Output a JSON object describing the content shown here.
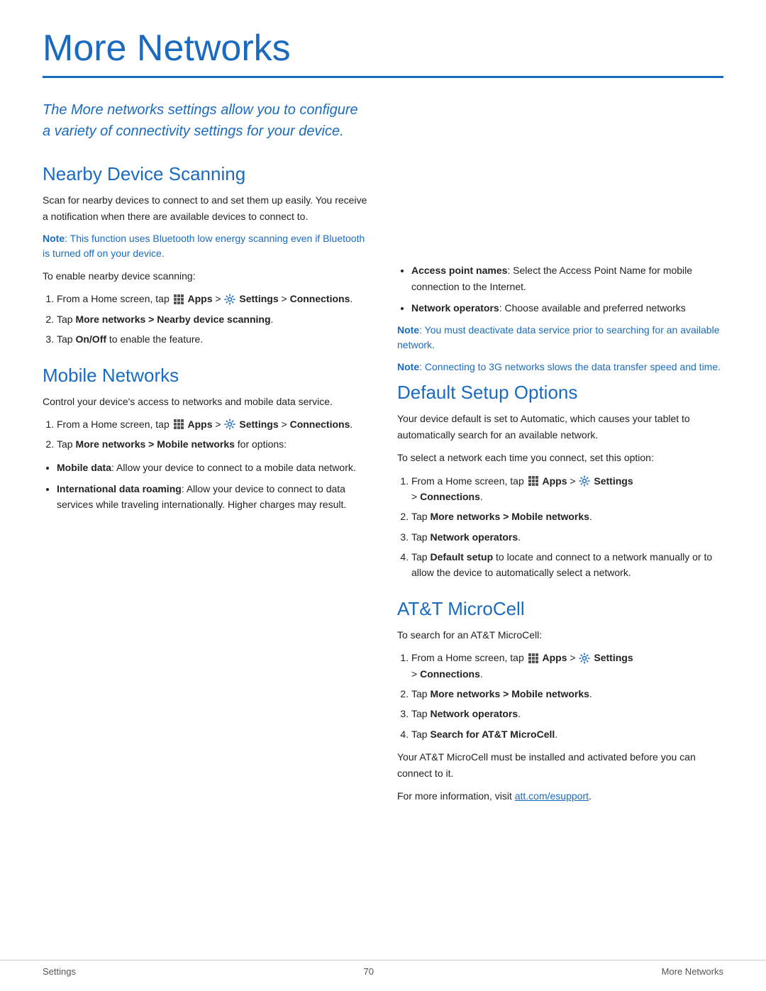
{
  "page": {
    "title": "More Networks",
    "divider": true,
    "intro": "The More networks settings allow you to configure a variety of connectivity settings for your device.",
    "footer": {
      "left": "Settings",
      "center": "70",
      "right": "More Networks"
    }
  },
  "left_column": {
    "nearby_section": {
      "title": "Nearby Device Scanning",
      "description": "Scan for nearby devices to connect to and set them up easily. You receive a notification when there are available devices to connect to.",
      "note": "Note: This function uses Bluetooth low energy scanning even if Bluetooth is turned off on your device.",
      "instructions_label": "To enable nearby device scanning:",
      "steps": [
        {
          "text": "From a Home screen, tap",
          "apps_icon": true,
          "apps_label": "Apps",
          "settings_icon": true,
          "settings_label": "Settings",
          "suffix": "> Connections."
        },
        {
          "text": "Tap More networks > Nearby device scanning.",
          "bold_part": "More networks > Nearby device scanning"
        },
        {
          "text": "Tap On/Off to enable the feature.",
          "bold_part": "On/Off"
        }
      ]
    },
    "mobile_section": {
      "title": "Mobile Networks",
      "description": "Control your device's access to networks and mobile data service.",
      "steps": [
        {
          "text_before": "From a Home screen, tap",
          "apps_icon": true,
          "apps_label": "Apps",
          "settings_icon": true,
          "settings_label": "Settings",
          "suffix": "> Connections."
        },
        {
          "text": "Tap More networks > Mobile networks for options:",
          "bold_part": "More networks > Mobile networks"
        }
      ],
      "bullet_items": [
        {
          "title": "Mobile data",
          "text": ": Allow your device to connect to a mobile data network."
        },
        {
          "title": "International data roaming",
          "text": ": Allow your device to connect to data services while traveling internationally. Higher charges may result."
        },
        {
          "title": "Access point names",
          "text": ": Select the Access Point Name for mobile connection to the Internet."
        },
        {
          "title": "Network operators",
          "text": ": Choose available and preferred networks"
        }
      ],
      "notes": [
        "Note: You must deactivate data service prior to searching for an available network.",
        "Note: Connecting to 3G networks slows the data transfer speed and time."
      ]
    }
  },
  "right_column": {
    "default_setup_section": {
      "title": "Default Setup Options",
      "description1": "Your device default is set to Automatic, which causes your tablet to automatically search for an available network.",
      "description2": "To select a network each time you connect, set this option:",
      "steps": [
        {
          "text_before": "From a Home screen, tap",
          "apps_icon": true,
          "apps_label": "Apps",
          "settings_icon": true,
          "settings_label": "Settings",
          "suffix": "> Connections."
        },
        {
          "text": "Tap More networks > Mobile networks.",
          "bold_part": "More networks > Mobile networks"
        },
        {
          "text": "Tap Network operators.",
          "bold_part": "Network operators"
        },
        {
          "text": "Tap Default setup to locate and connect to a network manually or to allow the device to automatically select a network.",
          "bold_part": "Default setup"
        }
      ]
    },
    "att_section": {
      "title": "AT&T MicroCell",
      "description": "To search for an AT&T MicroCell:",
      "steps": [
        {
          "text_before": "From a Home screen, tap",
          "apps_icon": true,
          "apps_label": "Apps",
          "settings_icon": true,
          "settings_label": "Settings",
          "suffix": "> Connections."
        },
        {
          "text": "Tap More networks > Mobile networks.",
          "bold_part": "More networks > Mobile networks"
        },
        {
          "text": "Tap Network operators.",
          "bold_part": "Network operators"
        },
        {
          "text": "Tap Search for AT&T MicroCell.",
          "bold_part": "Search for AT&T MicroCell"
        }
      ],
      "closing1": "Your AT&T MicroCell must be installed and activated before you can connect to it.",
      "closing2_before": "For more information, visit ",
      "link_text": "att.com/esupport",
      "closing2_after": "."
    }
  }
}
